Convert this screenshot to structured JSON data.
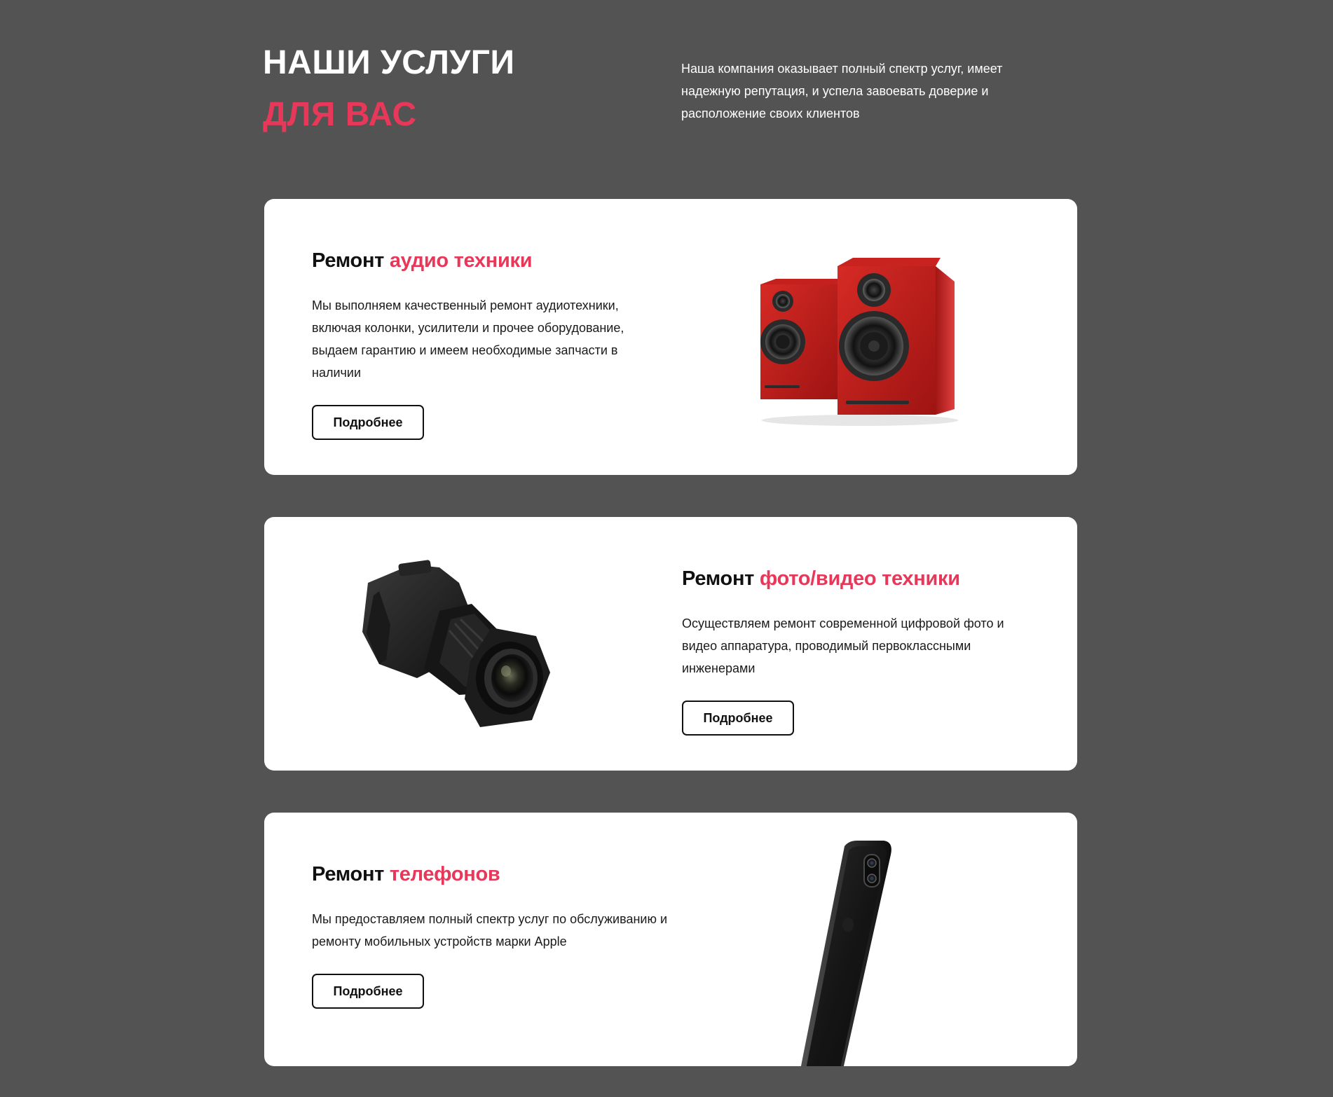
{
  "header": {
    "title_line1": "НАШИ УСЛУГИ",
    "title_line2": "ДЛЯ ВАС",
    "intro": "Наша компания оказывает полный спектр услуг, имеет надежную репутация, и успела завоевать доверие и расположение своих клиентов"
  },
  "services": [
    {
      "title_prefix": "Ремонт",
      "title_accent": "аудио техники",
      "description": "Мы выполняем качественный ремонт аудиотехники, включая колонки, усилители и прочее оборудование, выдаем гарантию и имеем необходимые запчасти в наличии",
      "button_label": "Подробнее",
      "image_icon": "speakers-image"
    },
    {
      "title_prefix": "Ремонт",
      "title_accent": "фото/видео техники",
      "description": "Осуществляем ремонт современной цифровой фото и видео аппаратура, проводимый первоклассными инженерами",
      "button_label": "Подробнее",
      "image_icon": "camera-image"
    },
    {
      "title_prefix": "Ремонт",
      "title_accent": "телефонов",
      "description": "Мы предоставляем полный спектр услуг по обслуживанию и ремонту мобильных устройств марки Apple",
      "button_label": "Подробнее",
      "image_icon": "phone-image"
    }
  ],
  "colors": {
    "background": "#535353",
    "accent": "#e8385a",
    "card": "#ffffff",
    "text": "#111111"
  }
}
